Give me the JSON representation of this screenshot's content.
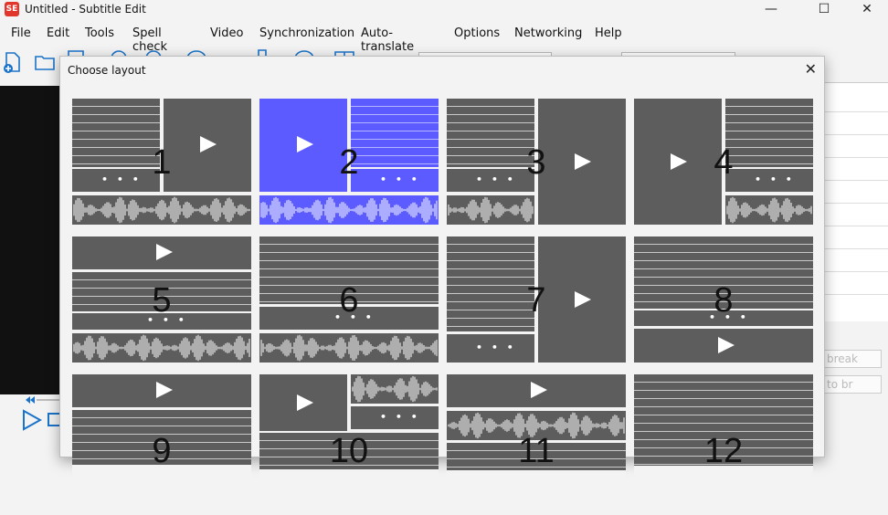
{
  "window": {
    "app_icon": "SE",
    "title": "Untitled - Subtitle Edit",
    "minimize": "—",
    "maximize": "☐",
    "close": "✕"
  },
  "menu": [
    "File",
    "Edit",
    "Tools",
    "Spell check",
    "Video",
    "Synchronization",
    "Auto-translate",
    "Options",
    "Networking",
    "Help"
  ],
  "toolbar_icons": [
    "new-file-icon",
    "open-folder-icon",
    "save-icon",
    "find-icon",
    "undo-icon",
    "help-icon",
    "video-icon",
    "settings-icon",
    "layout-icon"
  ],
  "right_panel": {
    "buttons": [
      "break",
      "to br"
    ]
  },
  "dialog": {
    "title": "Choose layout",
    "close": "✕",
    "layouts": [
      {
        "label": "1",
        "selected": false
      },
      {
        "label": "2",
        "selected": true
      },
      {
        "label": "3",
        "selected": false
      },
      {
        "label": "4",
        "selected": false
      },
      {
        "label": "5",
        "selected": false
      },
      {
        "label": "6",
        "selected": false
      },
      {
        "label": "7",
        "selected": false
      },
      {
        "label": "8",
        "selected": false
      },
      {
        "label": "9",
        "selected": false
      },
      {
        "label": "10",
        "selected": false
      },
      {
        "label": "11",
        "selected": false
      },
      {
        "label": "12",
        "selected": false
      }
    ],
    "colors": {
      "tile": "#5d5d5d",
      "selected": "#5b5bff",
      "line": "#c9c9c9"
    }
  }
}
